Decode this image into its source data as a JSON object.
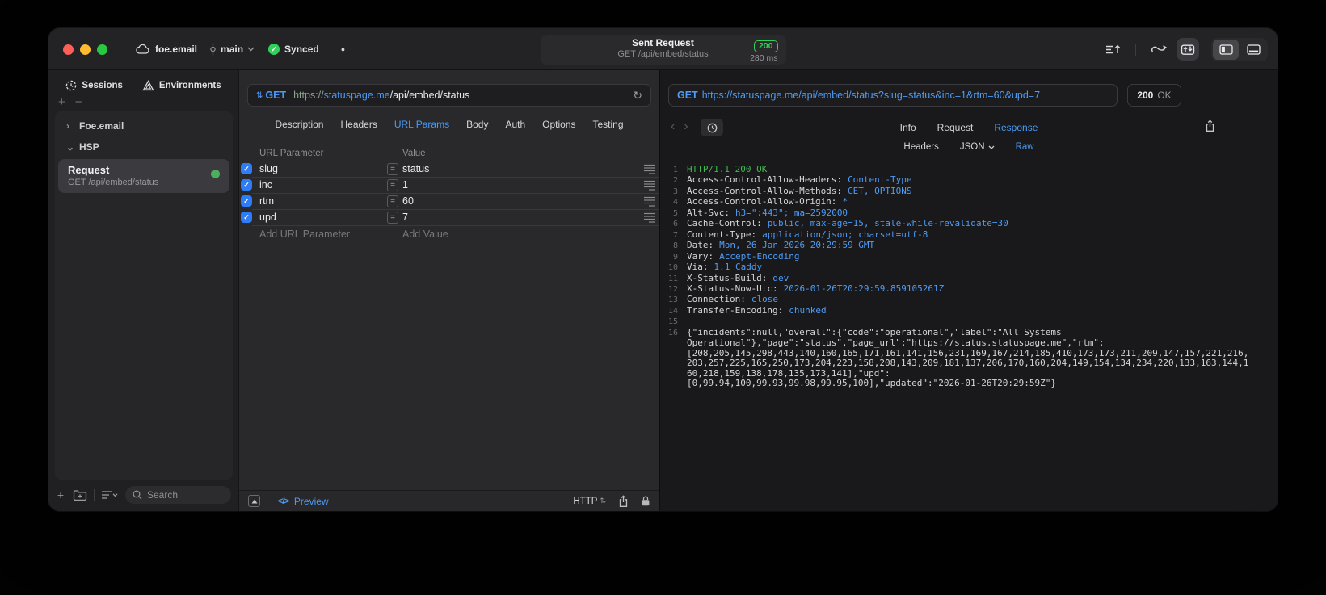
{
  "colors": {
    "accent_blue": "#4A9AF5",
    "success_green": "#30D158",
    "http_ok_green": "#3FBB4E",
    "checkbox_blue": "#2F7CF7",
    "window_bg": "#1D1D1F",
    "response_bg": "#19191B",
    "traffic_red": "#FF5F57",
    "traffic_yellow": "#FEBC2E",
    "traffic_green": "#28C840"
  },
  "icons": {
    "plus": "+",
    "minus": "−",
    "chevron_right": "›",
    "chevron_down": "⌄",
    "equals": "=",
    "check": "✓",
    "refresh": "↻",
    "back": "‹",
    "forward": "›",
    "code": "</>",
    "dot": "●",
    "updown": "⇅"
  },
  "titlebar": {
    "project": "foe.email",
    "branch": "main",
    "sync_status": "Synced",
    "center": {
      "title": "Sent Request",
      "subtitle": "GET /api/embed/status",
      "status_code": "200",
      "duration": "280 ms"
    }
  },
  "sidebar": {
    "tabs": [
      {
        "label": "Sessions"
      },
      {
        "label": "Environments"
      }
    ],
    "tree": [
      {
        "label": "Foe.email"
      },
      {
        "label": "HSP"
      }
    ],
    "request_item": {
      "title": "Request",
      "subtitle": "GET /api/embed/status"
    },
    "search_placeholder": "Search"
  },
  "request_pane": {
    "method": "GET",
    "url": {
      "scheme": "https://",
      "host": "statuspage.me",
      "path": "/api/embed/status"
    },
    "tabs": [
      "Description",
      "Headers",
      "URL Params",
      "Body",
      "Auth",
      "Options",
      "Testing"
    ],
    "active_tab": "URL Params",
    "table": {
      "col_param": "URL Parameter",
      "col_value": "Value",
      "rows": [
        {
          "name": "slug",
          "value": "status"
        },
        {
          "name": "inc",
          "value": "1"
        },
        {
          "name": "rtm",
          "value": "60"
        },
        {
          "name": "upd",
          "value": "7"
        }
      ],
      "add_param": "Add URL Parameter",
      "add_value": "Add Value"
    },
    "footer": {
      "preview_label": "Preview",
      "protocol": "HTTP"
    }
  },
  "response_pane": {
    "method": "GET",
    "url": "https://statuspage.me/api/embed/status?slug=status&inc=1&rtm=60&upd=7",
    "status": {
      "code": "200",
      "text": "OK"
    },
    "tabs": [
      "Info",
      "Request",
      "Response"
    ],
    "active_tab": "Response",
    "subtabs": [
      "Headers",
      "JSON",
      "Raw"
    ],
    "active_subtab": "Raw",
    "status_line": {
      "num": "1",
      "text": "HTTP/1.1 200 OK"
    },
    "headers": [
      {
        "num": "2",
        "name": "Access-Control-Allow-Headers:",
        "value": "Content-Type"
      },
      {
        "num": "3",
        "name": "Access-Control-Allow-Methods:",
        "value": "GET, OPTIONS"
      },
      {
        "num": "4",
        "name": "Access-Control-Allow-Origin:",
        "value": "*"
      },
      {
        "num": "5",
        "name": "Alt-Svc:",
        "value": "h3=\":443\"; ma=2592000"
      },
      {
        "num": "6",
        "name": "Cache-Control:",
        "value": "public, max-age=15, stale-while-revalidate=30"
      },
      {
        "num": "7",
        "name": "Content-Type:",
        "value": "application/json; charset=utf-8"
      },
      {
        "num": "8",
        "name": "Date:",
        "value": "Mon, 26 Jan 2026 20:29:59 GMT"
      },
      {
        "num": "9",
        "name": "Vary:",
        "value": "Accept-Encoding"
      },
      {
        "num": "10",
        "name": "Via:",
        "value": "1.1 Caddy"
      },
      {
        "num": "11",
        "name": "X-Status-Build:",
        "value": "dev"
      },
      {
        "num": "12",
        "name": "X-Status-Now-Utc:",
        "value": "2026-01-26T20:29:59.859105261Z"
      },
      {
        "num": "13",
        "name": "Connection:",
        "value": "close"
      },
      {
        "num": "14",
        "name": "Transfer-Encoding:",
        "value": "chunked"
      }
    ],
    "blank_line_num": "15",
    "body_rows": [
      {
        "num": "16",
        "text": "{\"incidents\":null,\"overall\":{\"code\":\"operational\",\"label\":\"All Systems"
      },
      {
        "num": "",
        "text": "Operational\"},\"page\":\"status\",\"page_url\":\"https://status.statuspage.me\",\"rtm\":"
      },
      {
        "num": "",
        "text": "[208,205,145,298,443,140,160,165,171,161,141,156,231,169,167,214,185,410,173,173,211,209,147,157,221,216,"
      },
      {
        "num": "",
        "text": "203,257,225,165,250,173,204,223,158,208,143,209,181,137,206,170,160,204,149,154,134,234,220,133,163,144,1"
      },
      {
        "num": "",
        "text": "60,218,159,138,178,135,173,141],\"upd\":"
      },
      {
        "num": "",
        "text": "[0,99.94,100,99.93,99.98,99.95,100],\"updated\":\"2026-01-26T20:29:59Z\"}"
      }
    ]
  }
}
